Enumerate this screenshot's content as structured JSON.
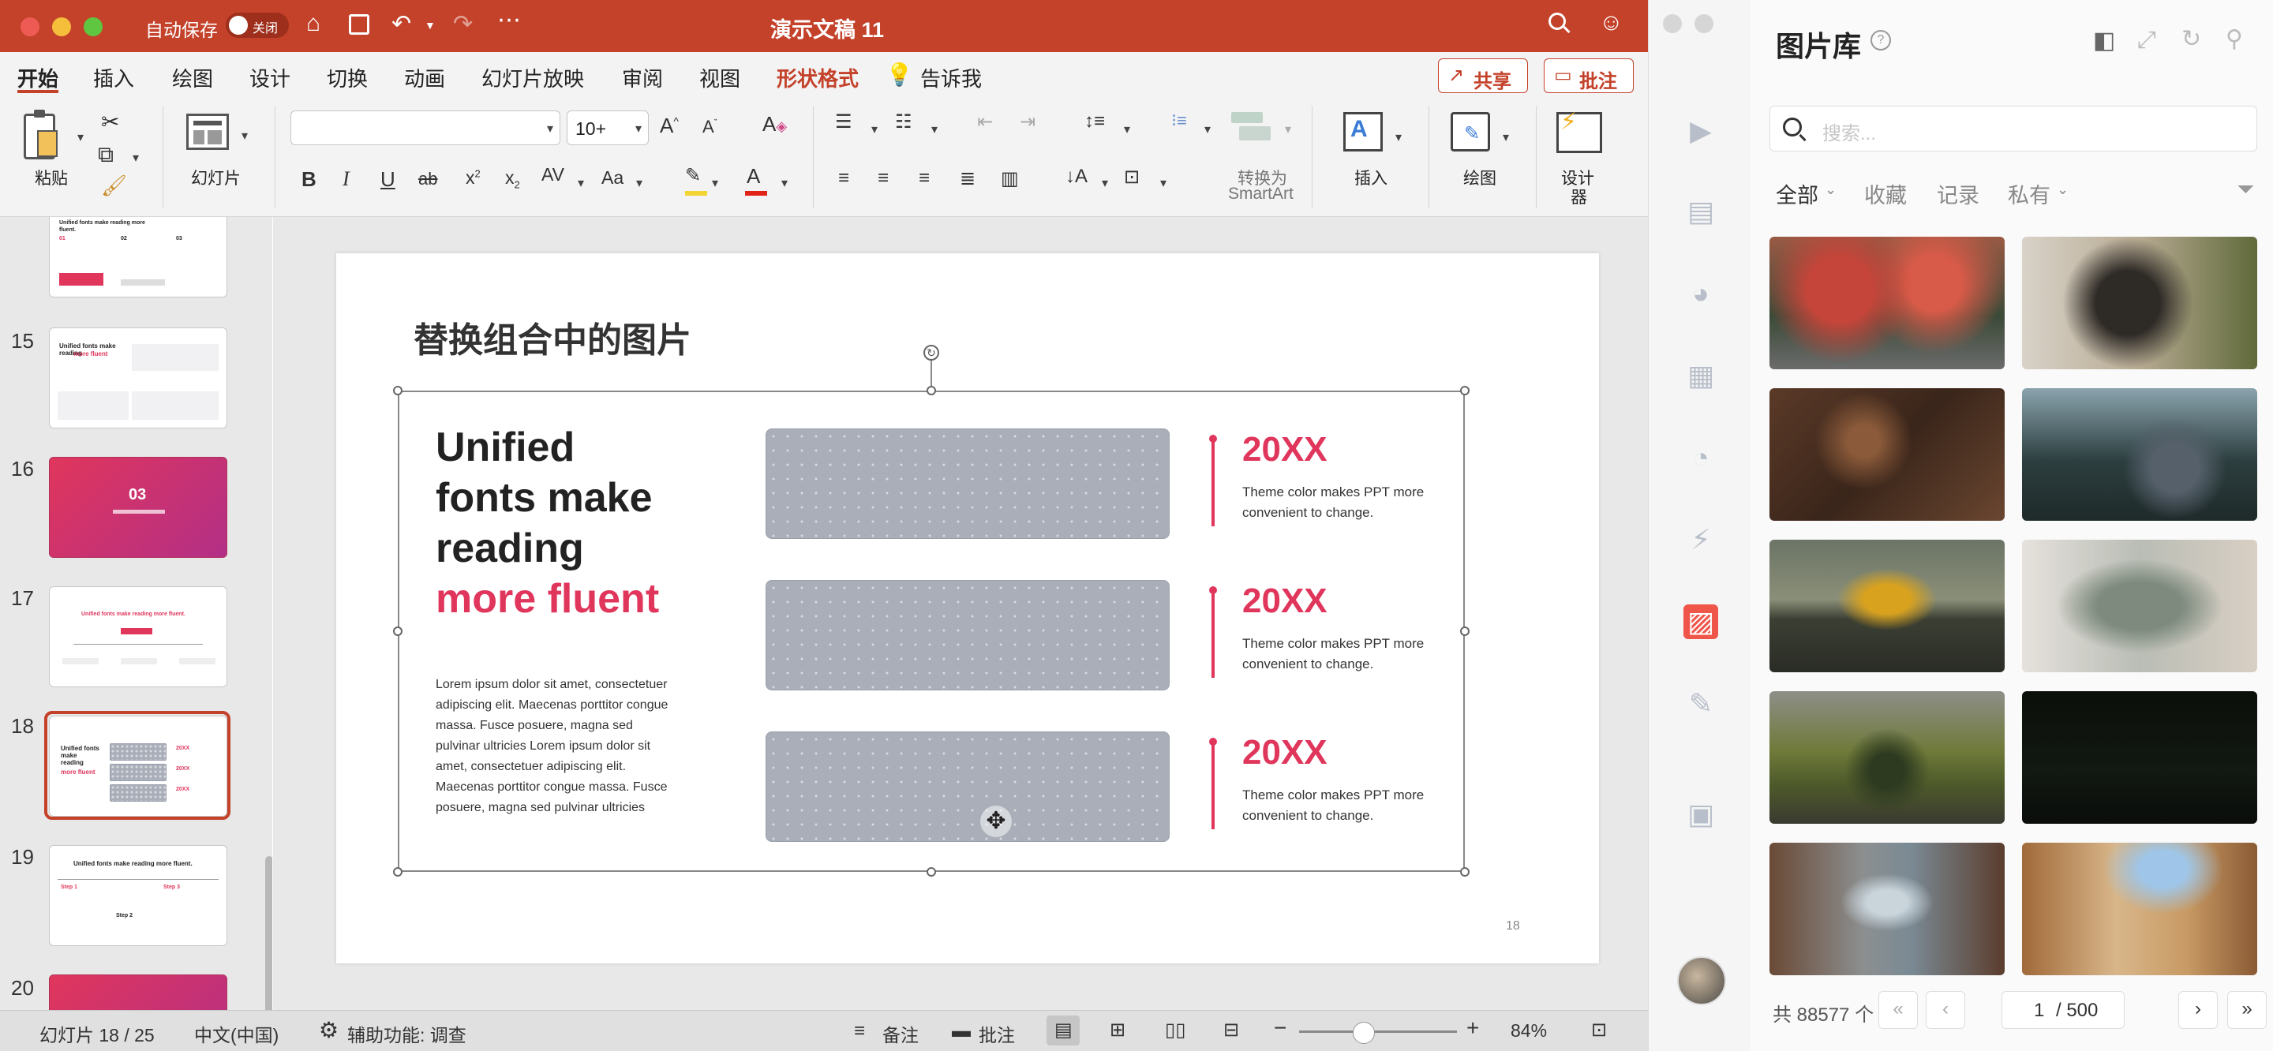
{
  "titlebar": {
    "autosave": "自动保存",
    "toggle": "关闭",
    "doc_title": "演示文稿 11"
  },
  "tabs": [
    "开始",
    "插入",
    "绘图",
    "设计",
    "切换",
    "动画",
    "幻灯片放映",
    "审阅",
    "视图",
    "形状格式"
  ],
  "tell_me": "告诉我",
  "share": "共享",
  "comments_btn": "批注",
  "ribbon": {
    "paste": "粘贴",
    "slides": "幻灯片",
    "font_size": "10+",
    "convert_smartart_1": "转换为",
    "convert_smartart_2": "SmartArt",
    "insert": "插入",
    "draw": "绘图",
    "designer_1": "设计",
    "designer_2": "器"
  },
  "thumbs": {
    "nums": [
      "15",
      "16",
      "17",
      "18",
      "19",
      "20"
    ],
    "t14_title": "Unified fonts make reading more fluent.",
    "t14_nums": [
      "01",
      "02",
      "03"
    ],
    "t15_title": "Unified fonts make reading",
    "t15_red": "more fluent",
    "t16_num": "03",
    "t17_title": "Unified fonts make reading more fluent.",
    "t18_title": "Unified fonts make reading",
    "t18_red": "more fluent",
    "t18_yr": "20XX",
    "t19_title": "Unified fonts make reading more fluent.",
    "t19_steps": [
      "Step 1",
      "Step 2",
      "Step 3"
    ]
  },
  "slide": {
    "title": "替换组合中的图片",
    "heading_1": "Unified",
    "heading_2": "fonts make",
    "heading_3": "reading",
    "heading_red": "more fluent",
    "body": "Lorem ipsum dolor sit amet, consectetuer adipiscing elit. Maecenas porttitor congue massa. Fusce posuere, magna sed pulvinar ultricies Lorem ipsum dolor sit amet, consectetuer adipiscing elit. Maecenas porttitor congue massa. Fusce posuere, magna sed pulvinar ultricies",
    "items": [
      {
        "year": "20XX",
        "desc": "Theme color makes PPT more convenient to change."
      },
      {
        "year": "20XX",
        "desc": "Theme color makes PPT more convenient to change."
      },
      {
        "year": "20XX",
        "desc": "Theme color makes PPT more convenient to change."
      }
    ],
    "page_num": "18"
  },
  "status": {
    "slide_pos": "幻灯片 18 / 25",
    "lang": "中文(中国)",
    "accessibility": "辅助功能: 调查",
    "notes": "备注",
    "comments": "批注",
    "zoom": "84%"
  },
  "library": {
    "title": "图片库",
    "search_placeholder": "搜索...",
    "filters": [
      "全部",
      "收藏",
      "记录",
      "私有"
    ],
    "total": "共 88577 个",
    "page": "1",
    "page_total": "/ 500"
  },
  "colors": {
    "accent": "#c4412a",
    "slide_red": "#e0365c",
    "lib_icon_active": "#f0554a"
  }
}
